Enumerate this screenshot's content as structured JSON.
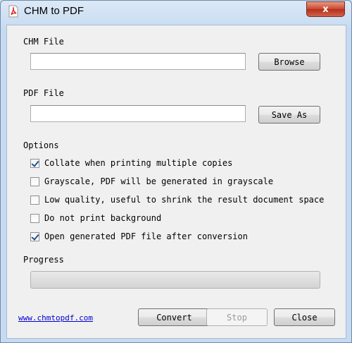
{
  "window": {
    "title": "CHM to PDF",
    "close_glyph": "x",
    "app_icon": "pdf-document-icon"
  },
  "chm_file": {
    "label": "CHM File",
    "value": "",
    "browse_label": "Browse"
  },
  "pdf_file": {
    "label": "PDF File",
    "value": "",
    "save_as_label": "Save As"
  },
  "options": {
    "label": "Options",
    "items": [
      {
        "label": "Collate when printing multiple copies",
        "checked": true
      },
      {
        "label": "Grayscale, PDF will be generated in grayscale",
        "checked": false
      },
      {
        "label": "Low quality, useful to shrink the result document space",
        "checked": false
      },
      {
        "label": "Do not print background",
        "checked": false
      },
      {
        "label": "Open generated PDF file after conversion",
        "checked": true
      }
    ]
  },
  "progress": {
    "label": "Progress",
    "value": 0
  },
  "footer": {
    "link_text": "www.chmtopdf.com",
    "convert_label": "Convert",
    "stop_label": "Stop",
    "close_label": "Close"
  },
  "colors": {
    "link": "#0000cc",
    "close_button": "#c9452d",
    "checkmark": "#21518a"
  }
}
